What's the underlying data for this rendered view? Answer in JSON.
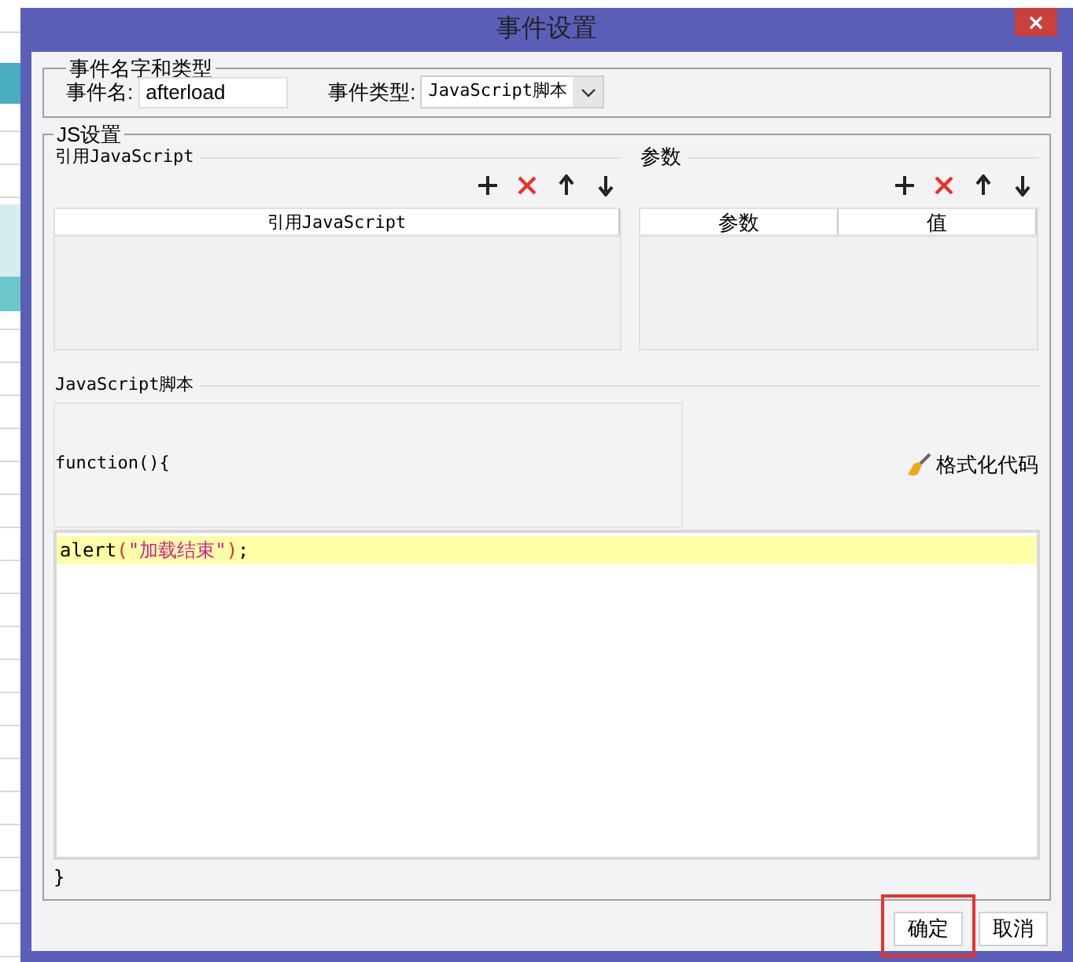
{
  "window": {
    "title": "事件设置"
  },
  "event_group": {
    "legend": "事件名字和类型",
    "name_label": "事件名:",
    "name_value": "afterload",
    "type_label": "事件类型:",
    "type_value": "JavaScript脚本"
  },
  "js_group": {
    "legend": "JS设置",
    "references": {
      "label": "引用JavaScript",
      "columns": [
        "引用JavaScript"
      ]
    },
    "params": {
      "label": "参数",
      "columns": [
        "参数",
        "值"
      ]
    },
    "script": {
      "legend": "JavaScript脚本",
      "header": "function(){",
      "format_button": "格式化代码",
      "lines": [
        {
          "highlighted": true,
          "tokens": [
            {
              "kind": "plain",
              "text": "alert"
            },
            {
              "kind": "paren",
              "text": "("
            },
            {
              "kind": "string",
              "text": "\"加载结束\""
            },
            {
              "kind": "paren",
              "text": ")"
            },
            {
              "kind": "plain",
              "text": ";"
            }
          ]
        }
      ],
      "footer": "}"
    }
  },
  "buttons": [
    {
      "label": "确定",
      "highlighted": true
    },
    {
      "label": "取消",
      "highlighted": false
    }
  ]
}
